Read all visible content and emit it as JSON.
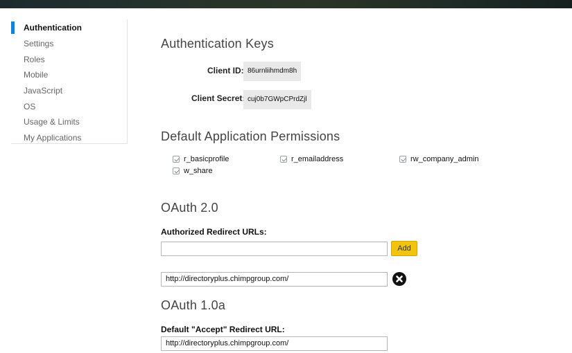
{
  "sidebar": {
    "items": [
      {
        "label": "Authentication",
        "active": true
      },
      {
        "label": "Settings"
      },
      {
        "label": "Roles"
      },
      {
        "label": "Mobile"
      },
      {
        "label": "JavaScript"
      },
      {
        "label": "OS"
      },
      {
        "label": "Usage & Limits"
      },
      {
        "label": "My Applications"
      }
    ]
  },
  "auth_keys": {
    "title": "Authentication Keys",
    "client_id_label": "Client ID:",
    "client_id_value": "86urnliihmdm8h",
    "client_secret_label": "Client Secret:",
    "client_secret_value": "cuj0b7GWpCPrdZjl"
  },
  "permissions": {
    "title": "Default Application Permissions",
    "items": [
      {
        "label": "r_basicprofile",
        "checked": true
      },
      {
        "label": "r_emailaddress",
        "checked": true
      },
      {
        "label": "rw_company_admin",
        "checked": true
      },
      {
        "label": "w_share",
        "checked": true
      }
    ]
  },
  "oauth2": {
    "title": "OAuth 2.0",
    "redirect_label": "Authorized Redirect URLs:",
    "new_url_value": "",
    "add_button": "Add",
    "urls": [
      "http://directoryplus.chimpgroup.com/"
    ]
  },
  "oauth1": {
    "title": "OAuth 1.0a",
    "accept_label": "Default \"Accept\" Redirect URL:",
    "accept_value": "http://directoryplus.chimpgroup.com/"
  },
  "colors": {
    "accent": "#0b85e0",
    "add_button": "#f1c40f"
  }
}
